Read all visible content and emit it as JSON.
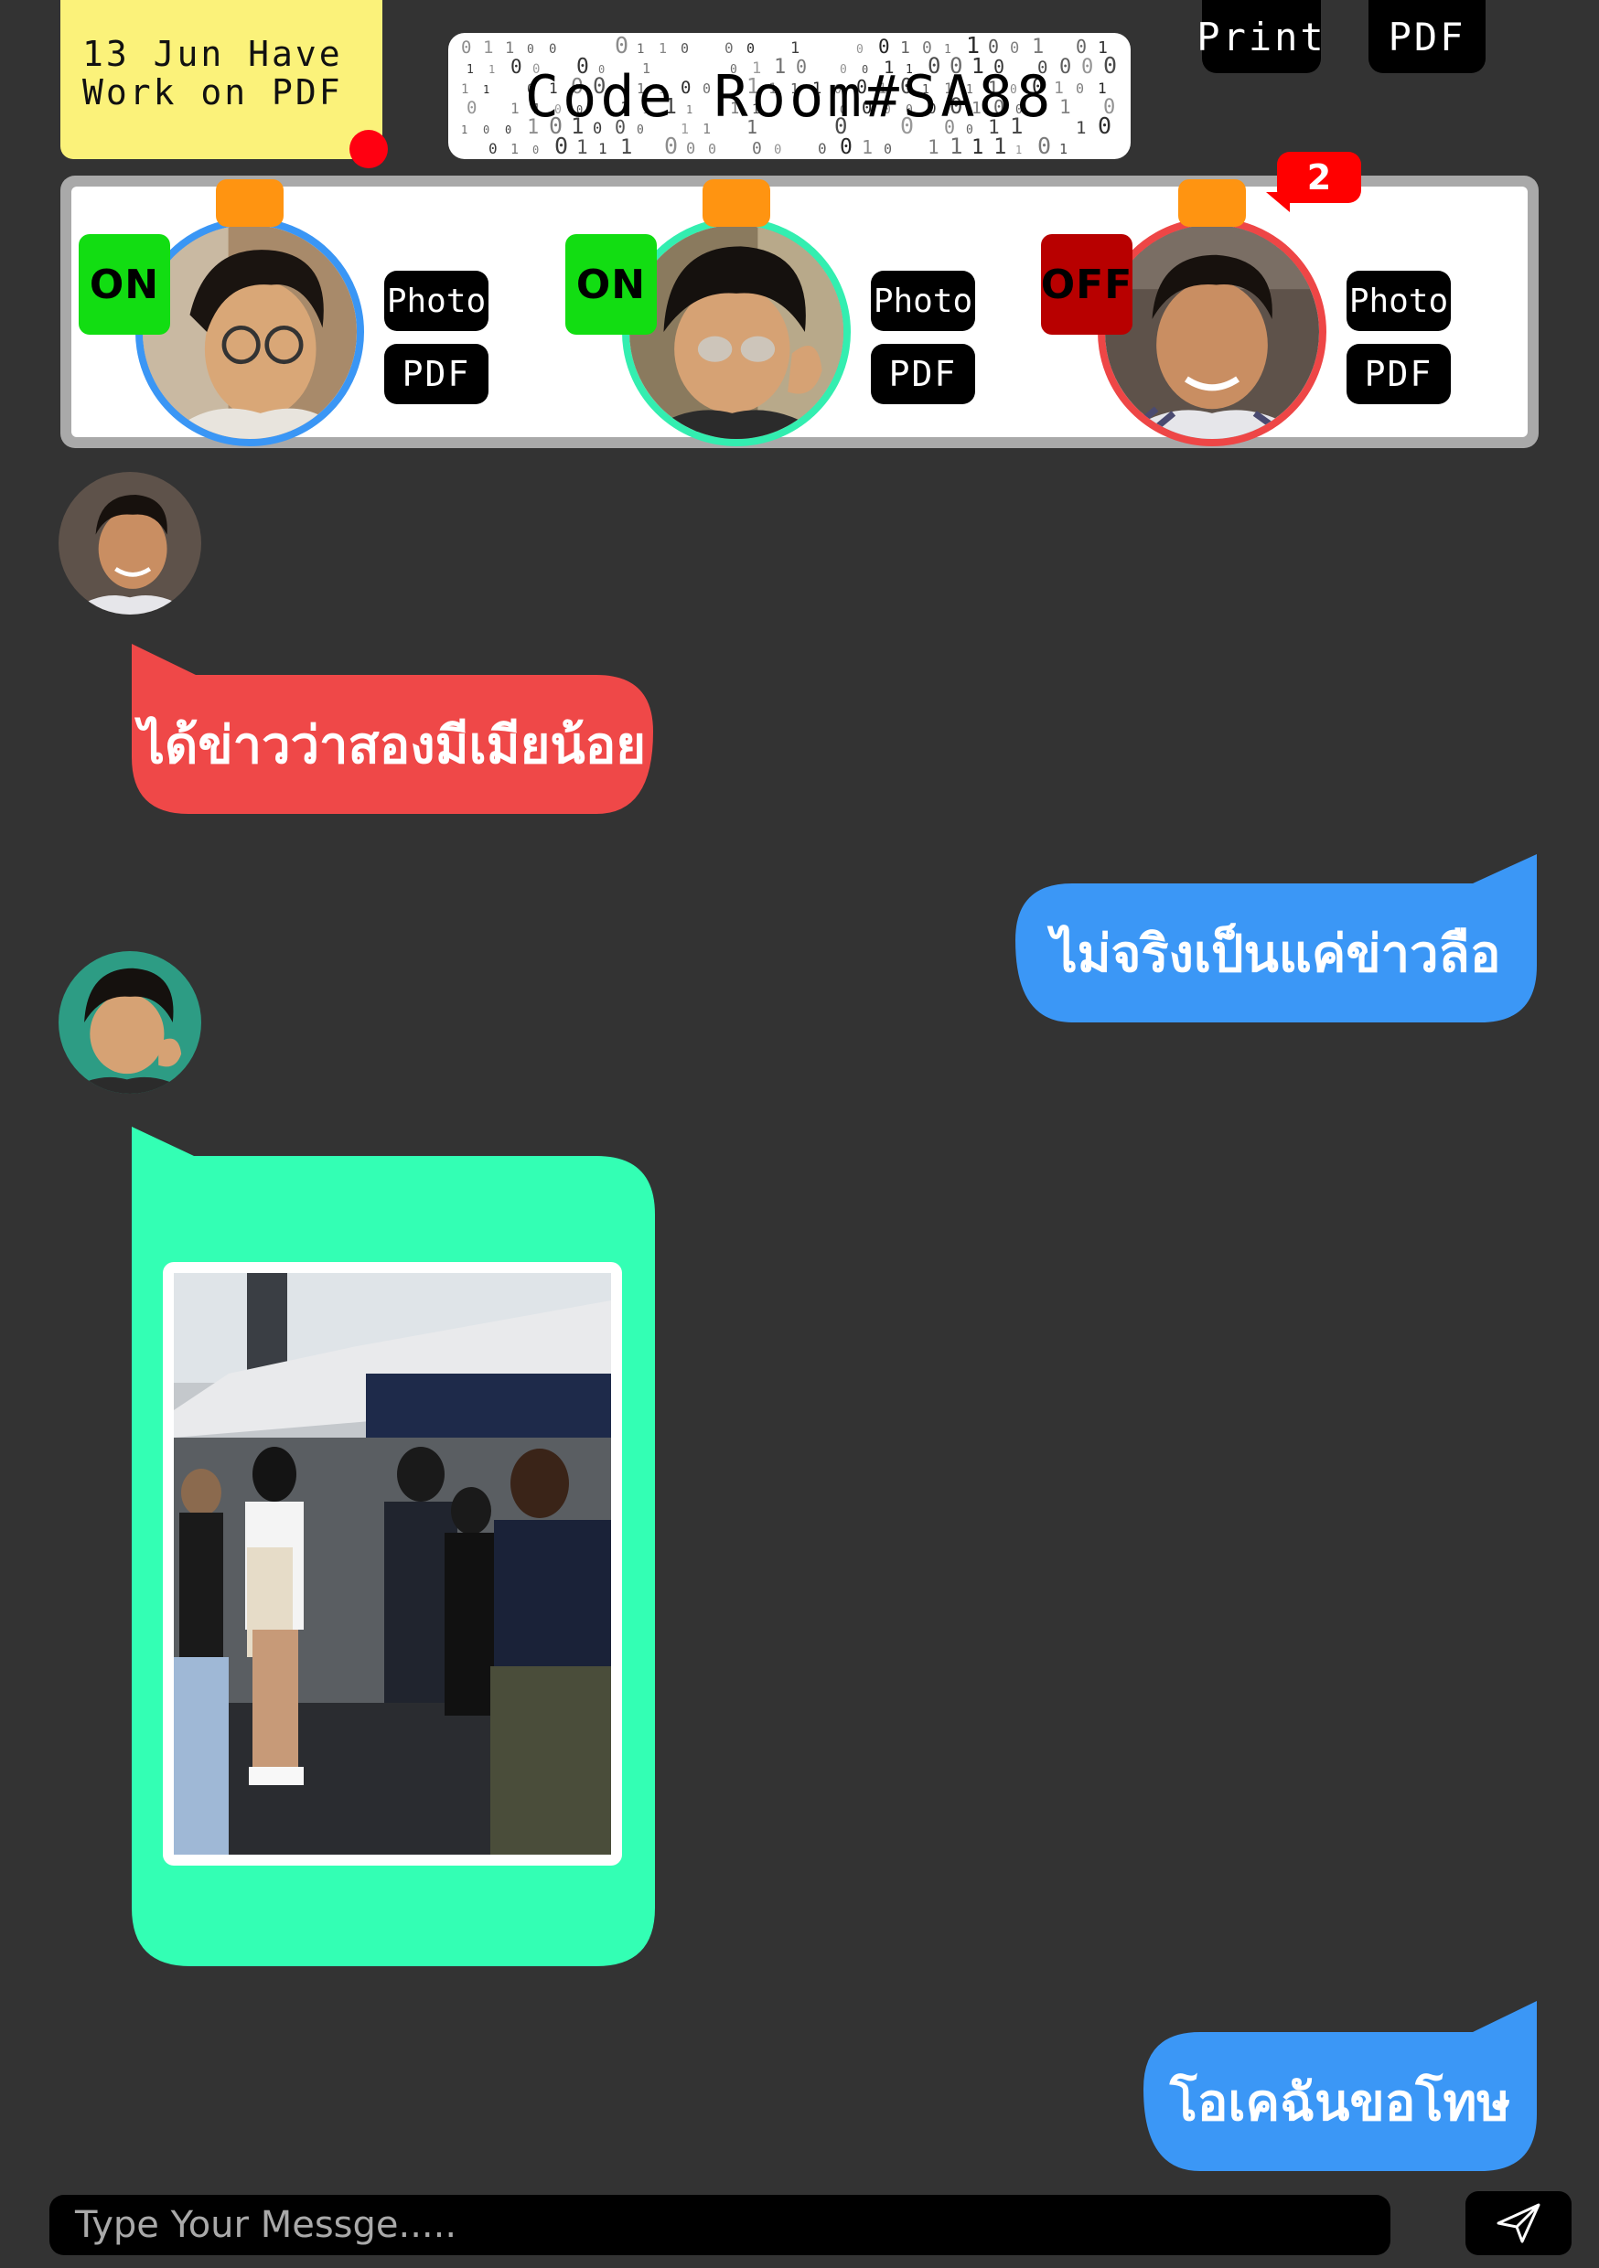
{
  "note": {
    "line1": "13 Jun Have",
    "line2": "Work on PDF"
  },
  "room": {
    "title": "Code Room#SA88"
  },
  "toolbar": {
    "print_label": "Print",
    "pdf_label": "PDF"
  },
  "members": [
    {
      "status": "ON",
      "status_color": "#12dd12",
      "status_text_color": "#000000",
      "ring_color": "#3a96f5",
      "photo_label": "Photo",
      "pdf_label": "PDF"
    },
    {
      "status": "ON",
      "status_color": "#12dd12",
      "status_text_color": "#000000",
      "ring_color": "#33eeb0",
      "photo_label": "Photo",
      "pdf_label": "PDF"
    },
    {
      "status": "OFF",
      "status_color": "#b80000",
      "status_text_color": "#000000",
      "ring_color": "#ee4646",
      "photo_label": "Photo",
      "pdf_label": "PDF",
      "notification_count": "2"
    }
  ],
  "messages": [
    {
      "side": "left",
      "text": "ได้ข่าวว่าสองมีเมียน้อย",
      "color": "#ef4848"
    },
    {
      "side": "right",
      "text": "ไม่จริงเป็นแค่ข่าวลือ",
      "color": "#3b97f6"
    },
    {
      "side": "left",
      "type": "photo",
      "color": "#33ffb4"
    },
    {
      "side": "right",
      "text": "โอเคฉันขอโทษ",
      "color": "#3b97f6"
    }
  ],
  "composer": {
    "placeholder": "Type Your Messge....."
  },
  "icons": {
    "send": "send-icon"
  }
}
